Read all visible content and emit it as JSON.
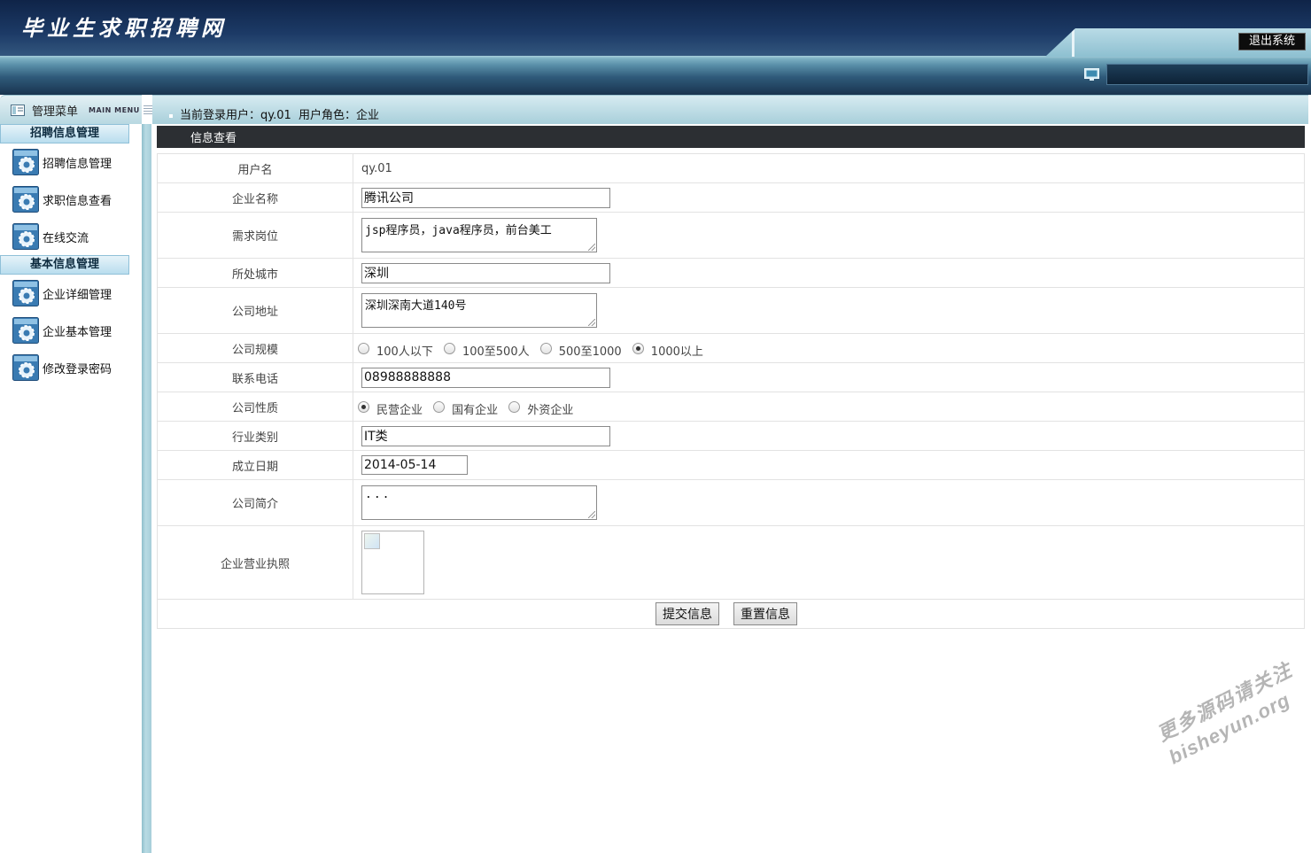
{
  "header": {
    "title": "毕业生求职招聘网",
    "logout_label": "退出系统",
    "icon": "monitor-icon"
  },
  "sidebar": {
    "title": "管理菜单",
    "subtitle": "MAIN MENU",
    "groups": [
      {
        "label": "招聘信息管理",
        "items": [
          {
            "label": "招聘信息管理",
            "icon": "gear-icon"
          },
          {
            "label": "求职信息查看",
            "icon": "gear-icon"
          },
          {
            "label": "在线交流",
            "icon": "gear-icon"
          }
        ]
      },
      {
        "label": "基本信息管理",
        "items": [
          {
            "label": "企业详细管理",
            "icon": "gear-icon"
          },
          {
            "label": "企业基本管理",
            "icon": "gear-icon"
          },
          {
            "label": "修改登录密码",
            "icon": "gear-icon"
          }
        ]
      }
    ]
  },
  "status": {
    "text": "当前登录用户：qy.01  用户角色：企业"
  },
  "panel": {
    "title": "信息查看"
  },
  "form": {
    "username": {
      "label": "用户名",
      "value": "qy.01"
    },
    "company_name": {
      "label": "企业名称",
      "value": "腾讯公司"
    },
    "positions": {
      "label": "需求岗位",
      "value": "jsp程序员，java程序员，前台美工"
    },
    "city": {
      "label": "所处城市",
      "value": "深圳"
    },
    "address": {
      "label": "公司地址",
      "value": "深圳深南大道140号"
    },
    "scale": {
      "label": "公司规模",
      "options": [
        "100人以下",
        "100至500人",
        "500至1000",
        "1000以上"
      ],
      "selected": "1000以上"
    },
    "phone": {
      "label": "联系电话",
      "value": "08988888888"
    },
    "nature": {
      "label": "公司性质",
      "options": [
        "民营企业",
        "国有企业",
        "外资企业"
      ],
      "selected": "民营企业"
    },
    "industry": {
      "label": "行业类别",
      "value": "IT类"
    },
    "founded": {
      "label": "成立日期",
      "value": "2014-05-14"
    },
    "intro": {
      "label": "公司简介",
      "value": "..."
    },
    "license": {
      "label": "企业营业执照"
    },
    "submit_label": "提交信息",
    "reset_label": "重置信息"
  },
  "watermark": {
    "line1": "更多源码请关注",
    "line2": "bisheyun.org"
  }
}
